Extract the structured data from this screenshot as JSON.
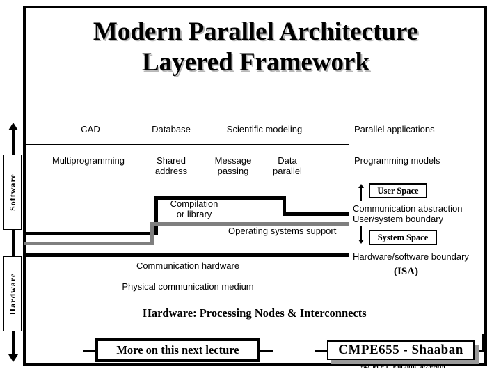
{
  "slide": {
    "title_line1": "Modern Parallel Architecture",
    "title_line2": "Layered Framework"
  },
  "side_labels": {
    "software": "Software",
    "hardware": "Hardware"
  },
  "layers": {
    "applications_row": [
      {
        "label": "CAD"
      },
      {
        "label": "Database"
      },
      {
        "label": "Scientific modeling"
      }
    ],
    "applications_name": "Parallel applications",
    "programming_row": [
      {
        "label": "Multiprogramming"
      },
      {
        "label": "Shared\naddress"
      },
      {
        "label": "Message\npassing"
      },
      {
        "label": "Data\nparallel"
      }
    ],
    "programming_name": "Programming models",
    "compilation": "Compilation\nor library",
    "os_support": "Operating systems support",
    "communication_hardware": "Communication hardware",
    "physical_medium": "Physical communication medium"
  },
  "right_annotations": {
    "user_space": "User Space",
    "system_space": "System Space",
    "communication_abstraction": "Communication abstraction",
    "user_system_boundary": "User/system boundary",
    "hardware_software_boundary": "Hardware/software boundary",
    "isa": "(ISA)"
  },
  "footer": {
    "hardware_caption": "Hardware:  Processing Nodes & Interconnects",
    "callout": "More on this next lecture",
    "course": "CMPE655 - Shaaban",
    "meta": "#47  lec # 1   Fall 2016   8-23-2016"
  },
  "colors": {
    "ink": "#000000",
    "gray_bar": "#7f7f7f",
    "title_shadow": "#b8b8b8",
    "sig_shadow": "#9a9a9a"
  }
}
